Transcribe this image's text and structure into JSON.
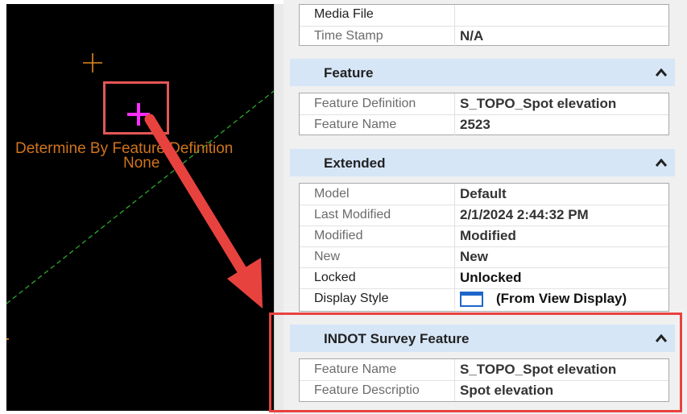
{
  "viewport": {
    "label_line1": "Determine By Feature Definition",
    "label_line2": "None",
    "marker_color": "#ff2dff",
    "point_color": "#e08a20",
    "line_color": "#2fb52f"
  },
  "sections": {
    "top": {
      "rows": [
        {
          "label": "Media File",
          "value": ""
        },
        {
          "label": "Time Stamp",
          "value": "N/A"
        }
      ]
    },
    "feature": {
      "title": "Feature",
      "rows": [
        {
          "label": "Feature Definition",
          "value": "S_TOPO_Spot elevation"
        },
        {
          "label": "Feature Name",
          "value": "2523"
        }
      ]
    },
    "extended": {
      "title": "Extended",
      "rows": [
        {
          "label": "Model",
          "value": "Default"
        },
        {
          "label": "Last Modified",
          "value": "2/1/2024 2:44:32 PM"
        },
        {
          "label": "Modified",
          "value": "Modified"
        },
        {
          "label": "New",
          "value": "New"
        },
        {
          "label": "Locked",
          "value": "Unlocked"
        },
        {
          "label": "Display Style",
          "value": "(From View Display)"
        }
      ]
    },
    "indot": {
      "title": "INDOT Survey Feature",
      "rows": [
        {
          "label": "Feature Name",
          "value": "S_TOPO_Spot elevation"
        },
        {
          "label": "Feature Descriptio",
          "value": "Spot elevation"
        }
      ]
    }
  },
  "icons": {
    "collapse": "chevron-up-icon",
    "display_style": "window-icon"
  },
  "colors": {
    "header_bg": "#d6e6f7",
    "highlight": "#e8423f"
  }
}
